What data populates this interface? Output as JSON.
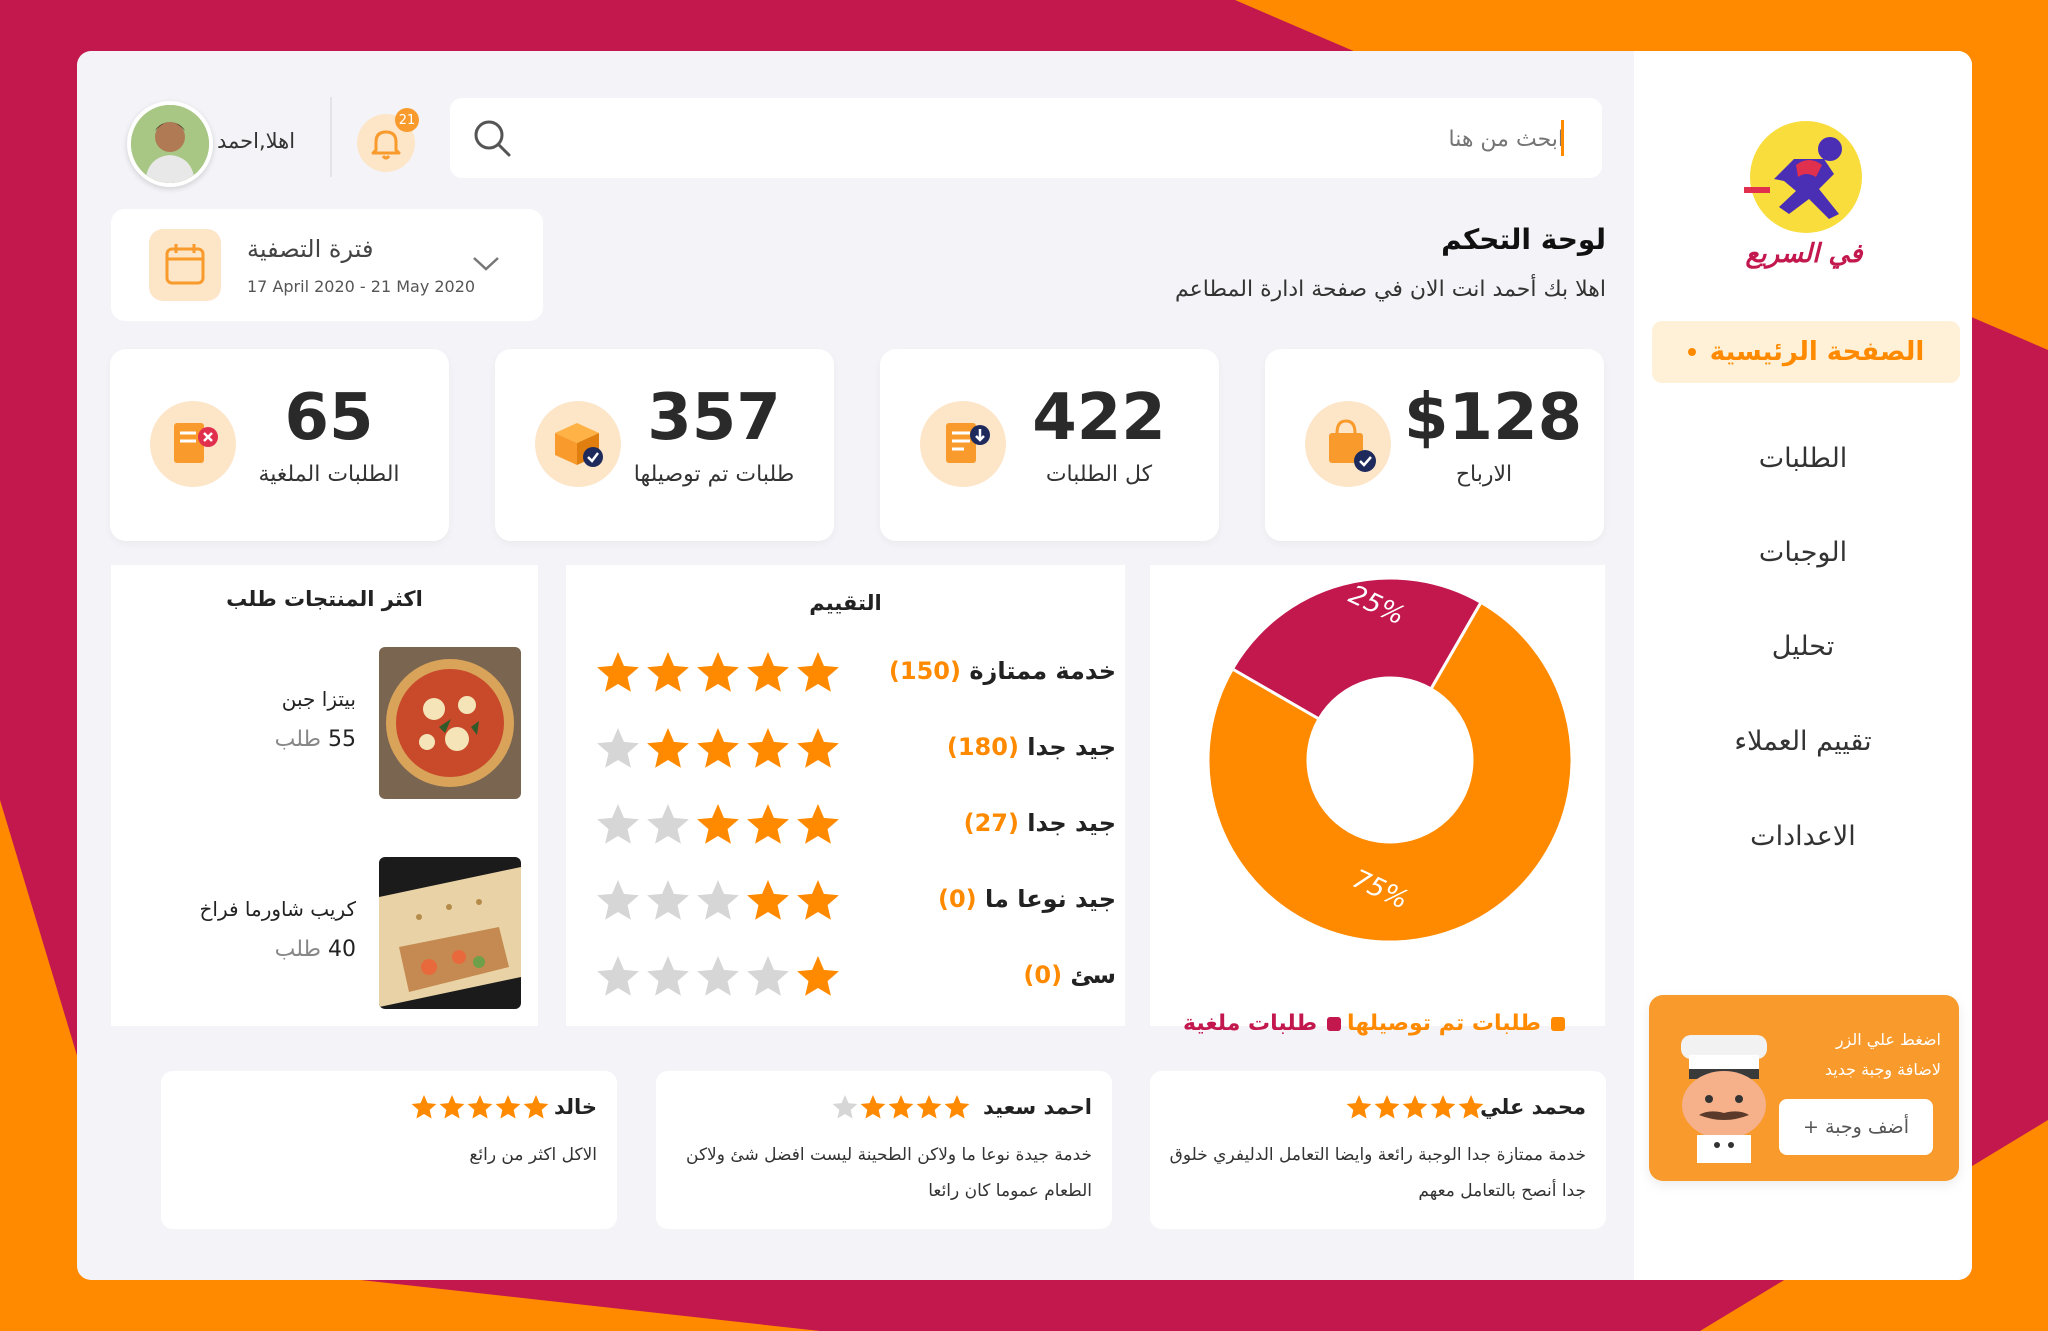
{
  "colors": {
    "primary": "#c2184e",
    "accent": "#ff8a00",
    "accent_soft": "#fde5c8"
  },
  "brand": {
    "logo_text": "في السريع"
  },
  "sidebar": {
    "active": "الصفحة الرئيسية",
    "items": [
      "الطلبات",
      "الوجبات",
      "تحليل",
      "تقييم العملاء",
      "الاعدادات"
    ]
  },
  "promo": {
    "line1": "اضغط علي الزر",
    "line2": "لاضافة وجبة جديد",
    "button": "أضف وجبة +"
  },
  "header": {
    "search_placeholder": "ابحث من هنا",
    "notification_count": "21",
    "user_greeting": "اهلا,احمد"
  },
  "filter": {
    "title": "فترة التصفية",
    "range": "17 April 2020 - 21 May 2020"
  },
  "page": {
    "title": "لوحة التحكم",
    "subtitle": "اهلا بك أحمد انت الان في صفحة ادارة المطاعم"
  },
  "stats": [
    {
      "value": "$128",
      "label": "الارباح",
      "icon": "shopping-bag-icon"
    },
    {
      "value": "422",
      "label": "كل الطلبات",
      "icon": "order-list-icon"
    },
    {
      "value": "357",
      "label": "طلبات تم توصيلها",
      "icon": "box-delivered-icon"
    },
    {
      "value": "65",
      "label": "الطلبات الملغية",
      "icon": "cancelled-order-icon"
    }
  ],
  "chart_data": {
    "type": "pie",
    "categories": [
      "طلبات تم توصيلها",
      "طلبات ملغية"
    ],
    "values": [
      75,
      25
    ],
    "labels": [
      "75%",
      "25%"
    ],
    "colors": [
      "#ff8a00",
      "#c2184e"
    ],
    "legend": "bottom"
  },
  "ratings": {
    "title": "التقييم",
    "rows": [
      {
        "label": "خدمة ممتازة",
        "count": "(150)",
        "stars": 5
      },
      {
        "label": "جيد جدا",
        "count": "(180)",
        "stars": 4
      },
      {
        "label": "جيد جدا",
        "count": "(27)",
        "stars": 3
      },
      {
        "label": "جيد نوعا ما",
        "count": "(0)",
        "stars": 2
      },
      {
        "label": "سئ",
        "count": "(0)",
        "stars": 1
      }
    ]
  },
  "top_products": {
    "title": "اكثر المنتجات طلب",
    "items": [
      {
        "name": "بيتزا جبن",
        "count": "55",
        "unit": "طلب"
      },
      {
        "name": "كريب شاورما فراخ",
        "count": "40",
        "unit": "طلب"
      }
    ]
  },
  "reviews": [
    {
      "name": "محمد علي",
      "stars": 5,
      "text": "خدمة ممتازة جدا الوجبة رائعة وايضا التعامل الدليفري خلوق جدا أنصح بالتعامل معهم"
    },
    {
      "name": "احمد سعيد",
      "stars": 4,
      "text": "خدمة جيدة نوعا ما ولاكن الطحينة ليست افضل شئ ولاكن الطعام عموما كان رائعا"
    },
    {
      "name": "خالد",
      "stars": 5,
      "text": "الاكل اكثر من رائع"
    }
  ]
}
